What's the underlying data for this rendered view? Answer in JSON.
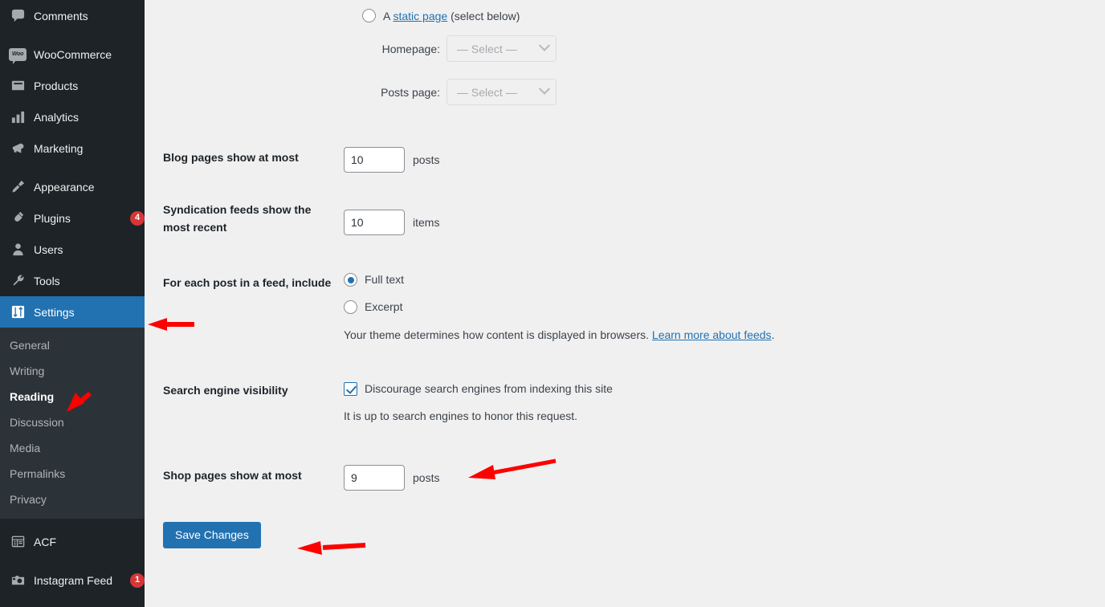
{
  "colors": {
    "sidebar_bg": "#1d2327",
    "submenu_bg": "#2c3338",
    "active_blue": "#2271b1",
    "badge_red": "#d63638",
    "annotation_red": "#ff0000",
    "content_bg": "#f0f0f1"
  },
  "sidebar": {
    "items": [
      {
        "label": "Comments",
        "icon": "comments-icon",
        "badge": null
      },
      {
        "label": "WooCommerce",
        "icon": "woocommerce-icon",
        "badge": null
      },
      {
        "label": "Products",
        "icon": "products-icon",
        "badge": null
      },
      {
        "label": "Analytics",
        "icon": "analytics-icon",
        "badge": null
      },
      {
        "label": "Marketing",
        "icon": "marketing-megaphone-icon",
        "badge": null
      },
      {
        "label": "Appearance",
        "icon": "appearance-brush-icon",
        "badge": null
      },
      {
        "label": "Plugins",
        "icon": "plugins-plug-icon",
        "badge": "4"
      },
      {
        "label": "Users",
        "icon": "users-icon",
        "badge": null
      },
      {
        "label": "Tools",
        "icon": "tools-wrench-icon",
        "badge": null
      },
      {
        "label": "Settings",
        "icon": "settings-sliders-icon",
        "badge": null,
        "active": true
      }
    ],
    "submenu": [
      {
        "label": "General",
        "current": false
      },
      {
        "label": "Writing",
        "current": false
      },
      {
        "label": "Reading",
        "current": true
      },
      {
        "label": "Discussion",
        "current": false
      },
      {
        "label": "Media",
        "current": false
      },
      {
        "label": "Permalinks",
        "current": false
      },
      {
        "label": "Privacy",
        "current": false
      }
    ],
    "lower_items": [
      {
        "label": "ACF",
        "icon": "acf-table-icon",
        "badge": null
      },
      {
        "label": "Instagram Feed",
        "icon": "instagram-camera-icon",
        "badge": "1"
      }
    ]
  },
  "main": {
    "front_page": {
      "static_radio_prefix": "A ",
      "static_link_text": "static page",
      "static_radio_suffix": " (select below)",
      "static_selected": false,
      "homepage_label": "Homepage:",
      "homepage_value": "— Select —",
      "posts_page_label": "Posts page:",
      "posts_page_value": "— Select —"
    },
    "blog_pages": {
      "label": "Blog pages show at most",
      "value": "10",
      "unit": "posts"
    },
    "syndication": {
      "label": "Syndication feeds show the most recent",
      "value": "10",
      "unit": "items"
    },
    "feed_include": {
      "label": "For each post in a feed, include",
      "option_full": "Full text",
      "option_excerpt": "Excerpt",
      "selected": "Full text",
      "description_prefix": "Your theme determines how content is displayed in browsers. ",
      "description_link": "Learn more about feeds",
      "description_suffix": "."
    },
    "search_visibility": {
      "label": "Search engine visibility",
      "checkbox_label": "Discourage search engines from indexing this site",
      "checked": true,
      "description": "It is up to search engines to honor this request."
    },
    "shop_pages": {
      "label": "Shop pages show at most",
      "value": "9",
      "unit": "posts"
    },
    "save_button": "Save Changes"
  },
  "annotations": [
    {
      "name": "arrow-to-settings",
      "target": "Settings menu item"
    },
    {
      "name": "arrow-to-reading",
      "target": "Reading submenu item"
    },
    {
      "name": "arrow-to-shop-pages-field",
      "target": "Shop pages number input"
    },
    {
      "name": "arrow-to-save-button",
      "target": "Save Changes button"
    }
  ]
}
